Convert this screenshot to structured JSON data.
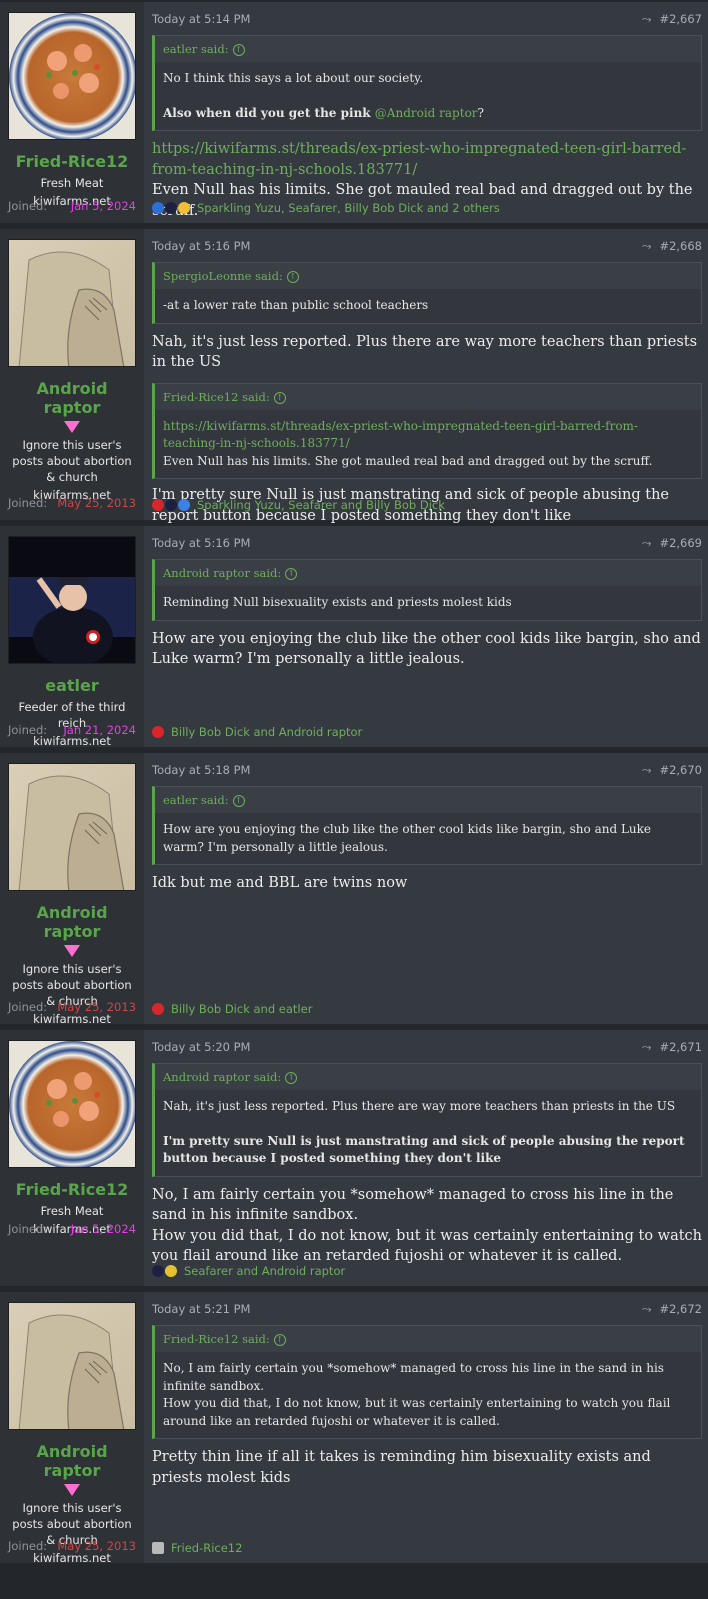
{
  "common": {
    "joined_label": "Joined:",
    "said_suffix": " said:"
  },
  "posts": [
    {
      "time": "Today at 5:14 PM",
      "number": "#2,667",
      "user": {
        "name": "Fried-Rice12",
        "title": "Fresh Meat",
        "site": "kiwifarms.net",
        "joined": "Jan 5, 2024"
      },
      "quote_author": "eatler said:",
      "quote_line1": "No I think this says a lot about our society.",
      "quote_line2_bold": "Also when did you get the pink ",
      "quote_line2_mention": "@Android raptor",
      "quote_line2_end": "?",
      "link": "https://kiwifarms.st/threads/ex-priest-who-impregnated-teen-girl-barred-from-teaching-in-nj-schools.183771/",
      "text": "Even Null has his limits. She got mauled real bad and dragged out by the scruff.",
      "reactions": "Sparkling Yuzu, Seafarer, Billy Bob Dick and 2 others"
    },
    {
      "time": "Today at 5:16 PM",
      "number": "#2,668",
      "user": {
        "name": "Android raptor",
        "title": "Ignore this user's posts about abortion & church",
        "site": "kiwifarms.net",
        "joined": "May 25, 2013"
      },
      "quote1_author": "SpergioLeonne said:",
      "quote1_text": "-at a lower rate than public school teachers",
      "text1": "Nah, it's just less reported. Plus there are way more teachers than priests in the US",
      "quote2_author": "Fried-Rice12 said:",
      "quote2_link": "https://kiwifarms.st/threads/ex-priest-who-impregnated-teen-girl-barred-from-teaching-in-nj-schools.183771/",
      "quote2_text": "Even Null has his limits. She got mauled real bad and dragged out by the scruff.",
      "text2": "I'm pretty sure Null is just manstrating and sick of people abusing the report button because I posted something they don't like",
      "reactions": "Sparkling Yuzu, Seafarer and Billy Bob Dick"
    },
    {
      "time": "Today at 5:16 PM",
      "number": "#2,669",
      "user": {
        "name": "eatler",
        "title": "Feeder of the third reich",
        "site": "kiwifarms.net",
        "joined": "Jan 21, 2024"
      },
      "quote_author": "Android raptor said:",
      "quote_text": "Reminding Null bisexuality exists and priests molest kids",
      "text": "How are you enjoying the club like the other cool kids like bargin, sho and Luke warm? I'm personally a little jealous.",
      "reactions": "Billy Bob Dick and Android raptor"
    },
    {
      "time": "Today at 5:18 PM",
      "number": "#2,670",
      "user": {
        "name": "Android raptor",
        "title": "Ignore this user's posts about abortion & church",
        "site": "kiwifarms.net",
        "joined": "May 25, 2013"
      },
      "quote_author": "eatler said:",
      "quote_text": "How are you enjoying the club like the other cool kids like bargin, sho and Luke warm? I'm personally a little jealous.",
      "text": "Idk but me and BBL are twins now",
      "reactions": "Billy Bob Dick and eatler"
    },
    {
      "time": "Today at 5:20 PM",
      "number": "#2,671",
      "user": {
        "name": "Fried-Rice12",
        "title": "Fresh Meat",
        "site": "kiwifarms.net",
        "joined": "Jan 5, 2024"
      },
      "quote_author": "Android raptor said:",
      "quote_line1": "Nah, it's just less reported. Plus there are way more teachers than priests in the US",
      "quote_line2_bold": "I'm pretty sure Null is just manstrating and sick of people abusing the report button because I posted something they don't like",
      "text1": "No, I am fairly certain you *somehow* managed to cross his line in the sand in his infinite sandbox.",
      "text2": "How you did that, I do not know, but it was certainly entertaining to watch you flail around like an retarded fujoshi or whatever it is called.",
      "reactions": "Seafarer and Android raptor"
    },
    {
      "time": "Today at 5:21 PM",
      "number": "#2,672",
      "user": {
        "name": "Android raptor",
        "title": "Ignore this user's posts about abortion & church",
        "site": "kiwifarms.net",
        "joined": "May 25, 2013"
      },
      "quote_author": "Fried-Rice12 said:",
      "quote_line1": "No, I am fairly certain you *somehow* managed to cross his line in the sand in his infinite sandbox.",
      "quote_line2": "How you did that, I do not know, but it was certainly entertaining to watch you flail around like an retarded fujoshi or whatever it is called.",
      "text": "Pretty thin line if all it takes is reminding him bisexuality exists and priests molest kids",
      "reactions": "Fried-Rice12"
    }
  ]
}
